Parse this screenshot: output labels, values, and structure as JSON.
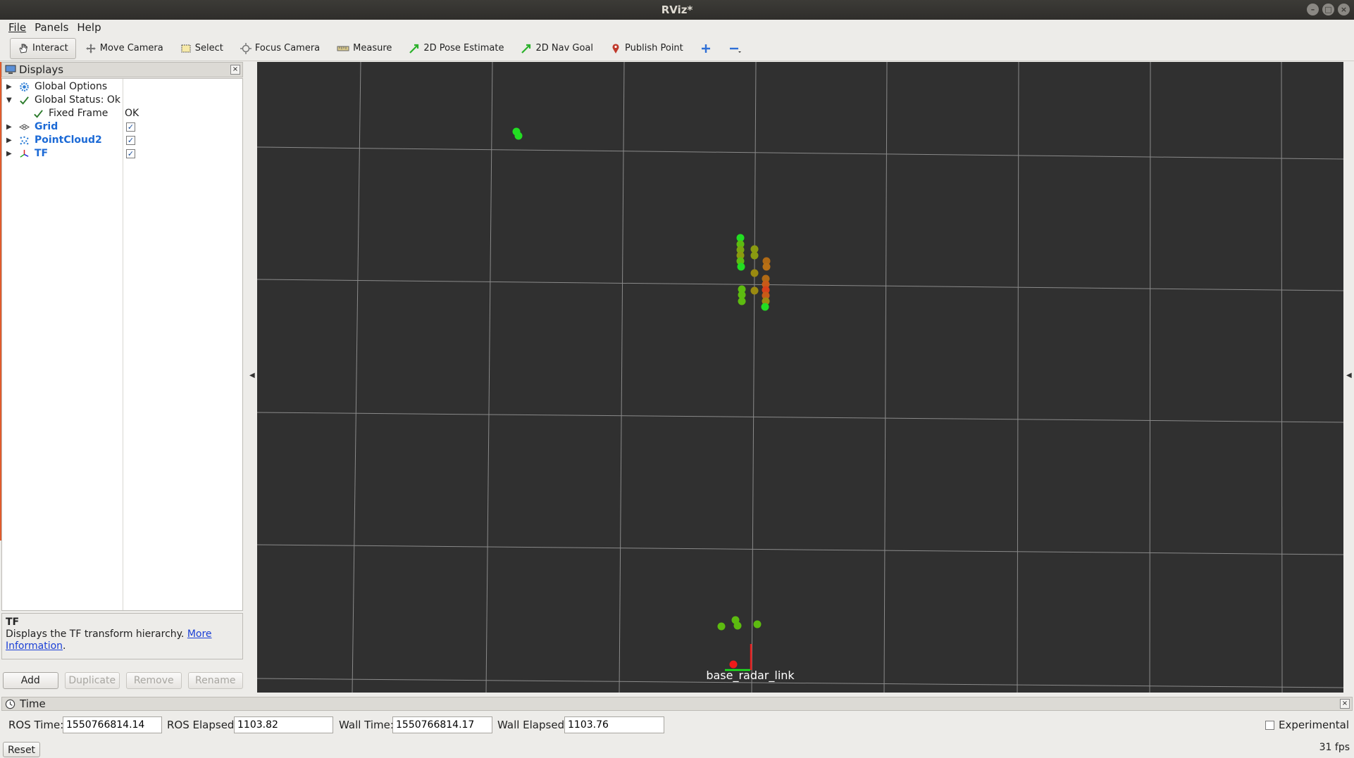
{
  "window": {
    "title": "RViz*"
  },
  "menu": [
    "File",
    "Panels",
    "Help"
  ],
  "toolbar": {
    "interact": "Interact",
    "move_camera": "Move Camera",
    "select": "Select",
    "focus_camera": "Focus Camera",
    "measure": "Measure",
    "pose_estimate": "2D Pose Estimate",
    "nav_goal": "2D Nav Goal",
    "publish_point": "Publish Point"
  },
  "displays": {
    "title": "Displays",
    "items": [
      {
        "label": "Global Options",
        "expanded": false,
        "icon": "gear-icon"
      },
      {
        "label": "Global Status: Ok",
        "expanded": true,
        "icon": "check-icon"
      },
      {
        "label": "Fixed Frame",
        "value": "OK",
        "icon": "check-icon"
      },
      {
        "label": "Grid",
        "checked": true,
        "icon": "grid-icon"
      },
      {
        "label": "PointCloud2",
        "checked": true,
        "icon": "pointcloud-icon"
      },
      {
        "label": "TF",
        "checked": true,
        "icon": "tf-icon"
      }
    ],
    "description": {
      "title": "TF",
      "text": "Displays the TF transform hierarchy.",
      "link1": "More",
      "link2": "Information",
      "tail": "."
    },
    "buttons": {
      "add": "Add",
      "duplicate": "Duplicate",
      "remove": "Remove",
      "rename": "Rename"
    }
  },
  "viewport": {
    "frame_label": "base_radar_link",
    "colors": {
      "background": "#303030",
      "grid": "#a0a0a0",
      "point_green": "#22dd22",
      "point_mid": "#8a9a10",
      "point_red": "#d8401a"
    }
  },
  "time": {
    "title": "Time",
    "ros_time_label": "ROS Time:",
    "ros_time": "1550766814.14",
    "ros_elapsed_label": "ROS Elapsed:",
    "ros_elapsed": "1103.82",
    "wall_time_label": "Wall Time:",
    "wall_time": "1550766814.17",
    "wall_elapsed_label": "Wall Elapsed:",
    "wall_elapsed": "1103.76",
    "experimental_label": "Experimental",
    "reset_label": "Reset",
    "fps": "31 fps"
  }
}
